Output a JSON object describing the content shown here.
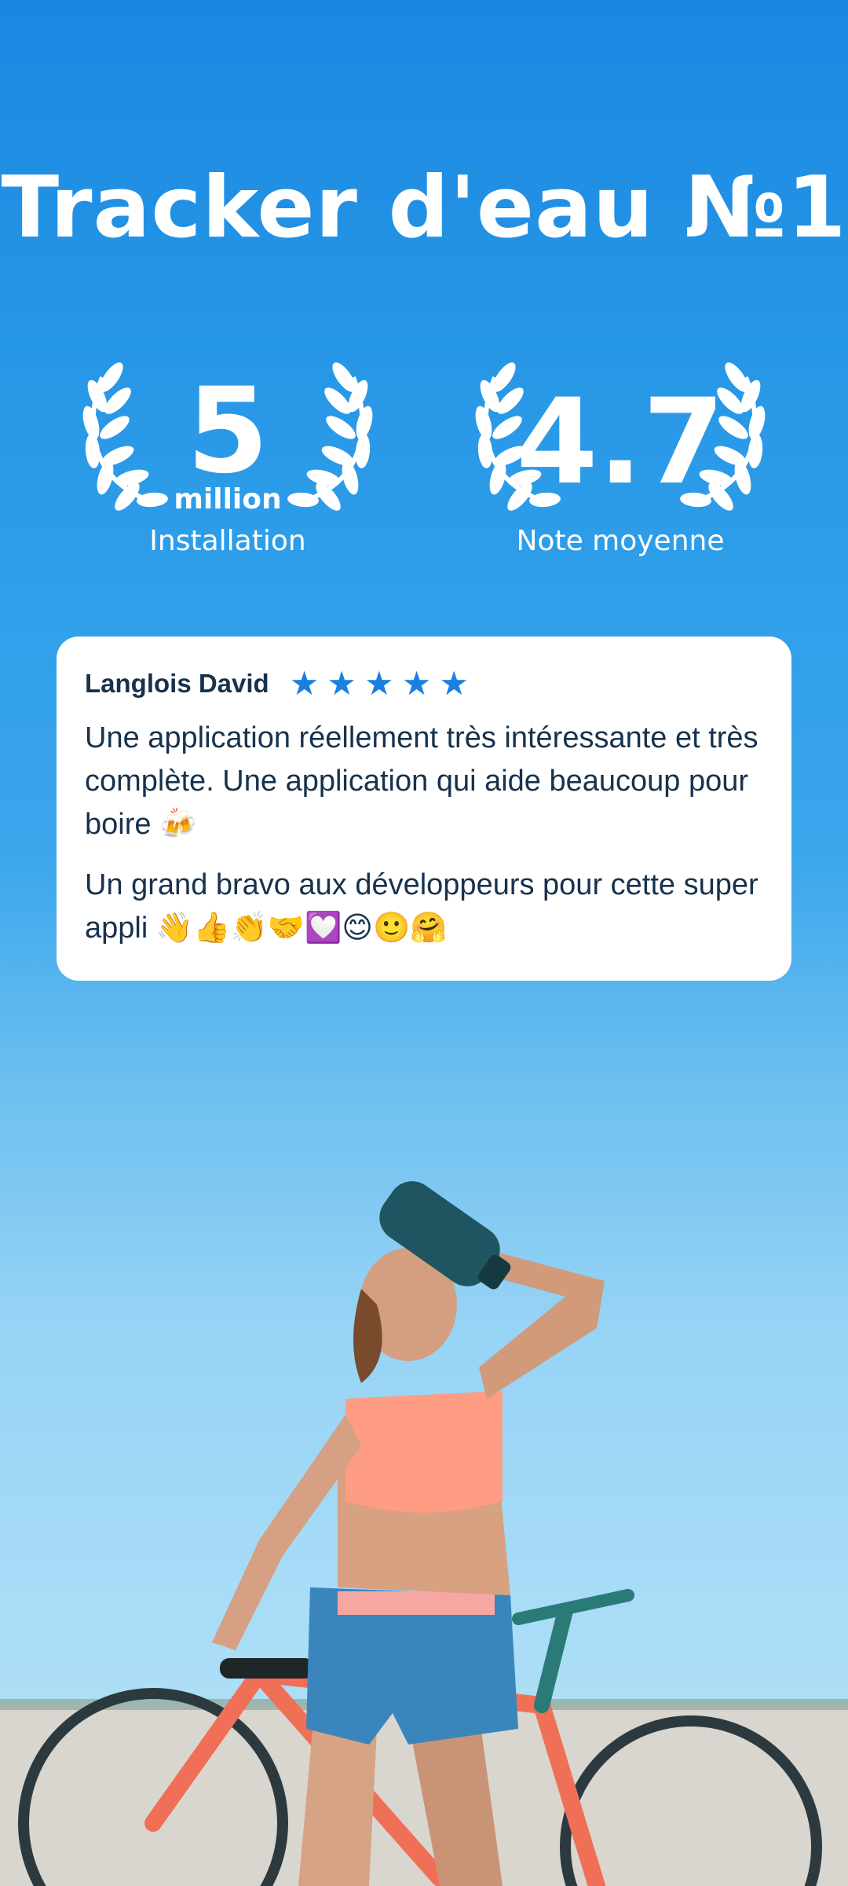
{
  "title": "Tracker d'eau №1",
  "stats": [
    {
      "value": "5",
      "unit": "million",
      "label": "Installation"
    },
    {
      "value": "4.7",
      "unit": "",
      "label": "Note moyenne"
    }
  ],
  "review": {
    "author": "Langlois David",
    "rating": 5,
    "paragraphs": [
      "Une application réellement très intéressante et très complète. Une application qui aide beaucoup pour boire 🍻",
      "Un grand bravo aux développeurs pour cette super appli 👋👍👏🤝💟😊🙂🤗"
    ]
  },
  "colors": {
    "background_top": "#1a88e1",
    "background_bottom": "#b6e1f5",
    "star": "#1a7fe0",
    "card": "#ffffff",
    "card_text": "#17324d"
  },
  "icons": [
    "laurel-wreath-icon",
    "star-icon"
  ],
  "photo": "woman drinking from water bottle next to bicycle"
}
